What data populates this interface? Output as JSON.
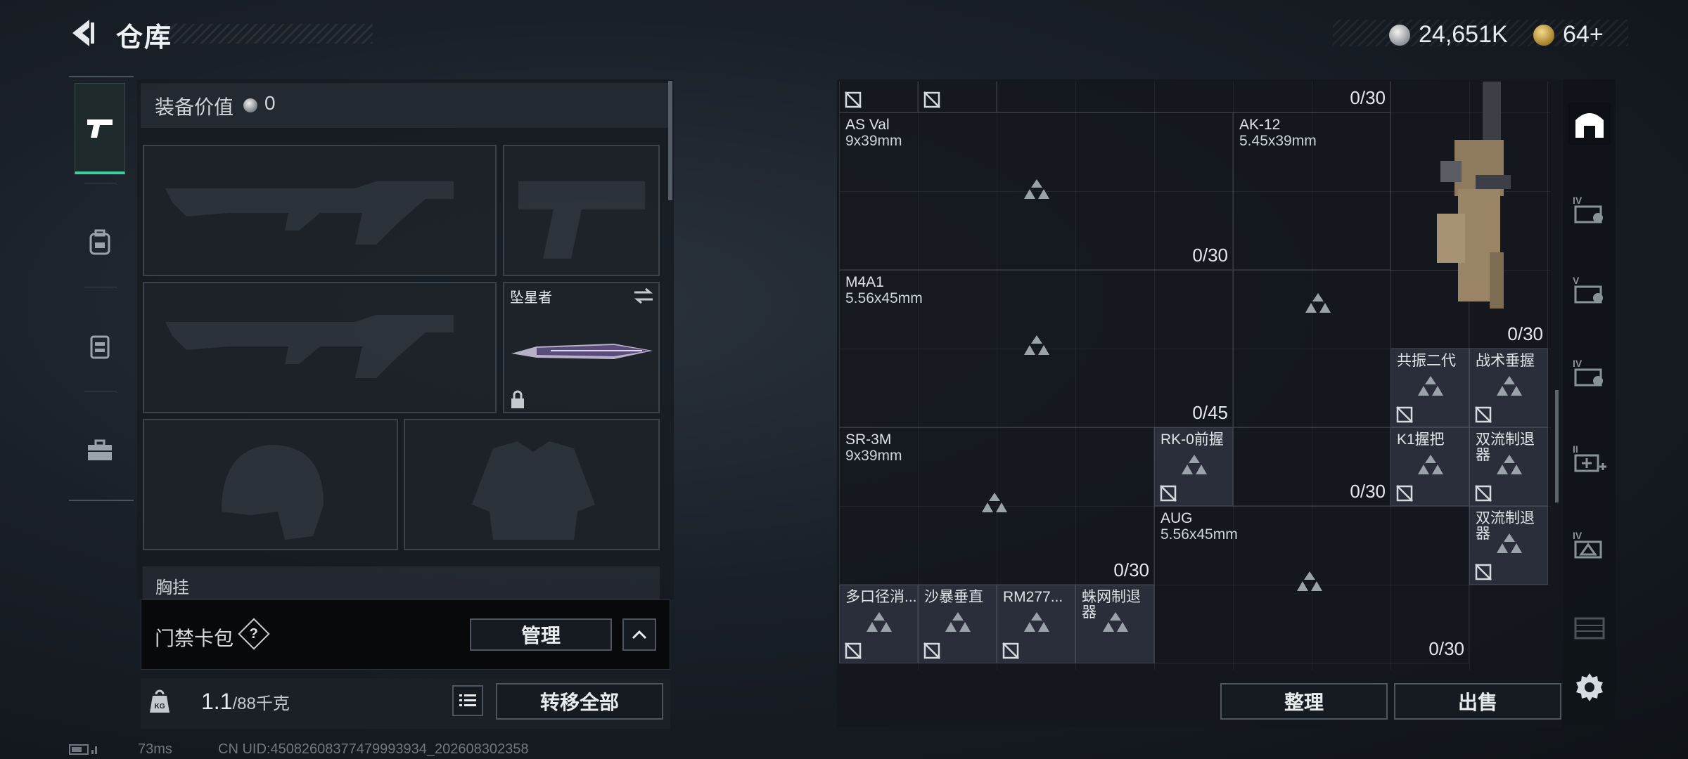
{
  "header": {
    "title": "仓库",
    "currency_silver": "24,651K",
    "currency_gold": "64+"
  },
  "left": {
    "equip_label": "装备价值",
    "equip_value": "0",
    "melee_name": "坠星者",
    "chest_label": "胸挂",
    "keycard_label": "门禁卡包",
    "help_glyph": "?",
    "manage_label": "管理",
    "weight_current": "1.1",
    "weight_max": "/88千克",
    "transfer_all_label": "转移全部"
  },
  "status": {
    "ping": "73ms",
    "uid": "CN UID:45082608377479993934_202608302358"
  },
  "storage": {
    "top_count": "0/30",
    "weapons": [
      {
        "name": "AS Val",
        "caliber": "9x39mm",
        "count": "0/30"
      },
      {
        "name": "AK-12",
        "caliber": "5.45x39mm",
        "count": "0/30"
      },
      {
        "name": "M4A1",
        "caliber": "5.56x45mm",
        "count": "0/45"
      },
      {
        "name": "SR-3M",
        "caliber": "9x39mm",
        "count": "0/30"
      },
      {
        "name": "AUG",
        "caliber": "5.56x45mm",
        "count": "0/30"
      }
    ],
    "right_weapon_count": "0/30",
    "rk_count": "0/30",
    "attachments": {
      "a1": "共振二代",
      "a2": "战术垂握",
      "a3": "K1握把",
      "a4": "双流制退器",
      "a5": "双流制退器",
      "a6": "RK-0前握",
      "a7": "多口径消...",
      "a8": "沙暴垂直",
      "a9": "RM277...",
      "a10": "蛛网制退器"
    }
  },
  "actions": {
    "sort_label": "整理",
    "sell_label": "出售"
  },
  "sidebar": {
    "tier_labels": [
      "IV",
      "V",
      "IV",
      "II",
      "IV"
    ]
  },
  "colors": {
    "accent": "#3fd0a0",
    "panel": "#161b21",
    "border": "#4d565f"
  }
}
